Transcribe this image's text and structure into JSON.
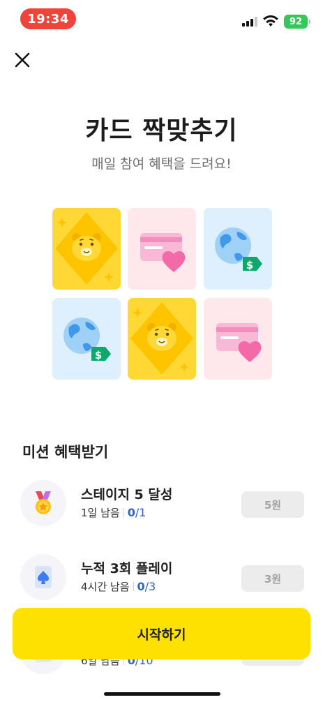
{
  "status_bar": {
    "time": "19:34",
    "battery": "92"
  },
  "header": {
    "close_icon": "close-icon"
  },
  "hero": {
    "title": "카드 짝맞추기",
    "subtitle": "매일 참여 혜택을 드려요!"
  },
  "cards": [
    {
      "kind": "lion",
      "color": "#ffd836"
    },
    {
      "kind": "credit-card-heart",
      "color": "#ffe8ec"
    },
    {
      "kind": "globe-money",
      "color": "#deeffd"
    },
    {
      "kind": "globe-money",
      "color": "#deeffd"
    },
    {
      "kind": "lion",
      "color": "#ffd836"
    },
    {
      "kind": "credit-card-heart",
      "color": "#ffe8ec"
    }
  ],
  "missions": {
    "section_title": "미션 혜택받기",
    "items": [
      {
        "icon": "medal-icon",
        "title": "스테이지 5 달성",
        "remaining": "1일 남음",
        "current": "0",
        "total": "/1",
        "reward": "5원"
      },
      {
        "icon": "spade-card-icon",
        "title": "누적 3회 플레이",
        "remaining": "4시간 남음",
        "current": "0",
        "total": "/3",
        "reward": "3원"
      },
      {
        "icon": "card-icon",
        "title": "",
        "remaining": "6일 남음",
        "current": "0",
        "total": "/10",
        "reward": ""
      }
    ]
  },
  "cta": {
    "start_label": "시작하기"
  },
  "colors": {
    "accent": "#ffe100",
    "progress": "#2d63c8",
    "status_time_bg": "#f0433a"
  }
}
